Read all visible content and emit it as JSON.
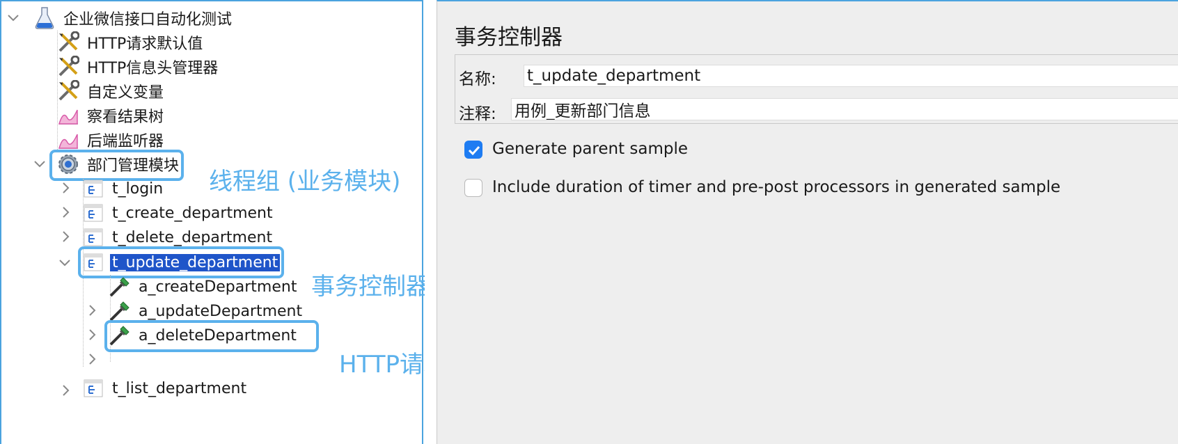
{
  "tree": {
    "root": {
      "label": "企业微信接口自动化测试",
      "icon": "test-plan-flask-icon"
    },
    "config_items": [
      {
        "label": "HTTP请求默认值",
        "icon": "wrench-screwdriver-icon"
      },
      {
        "label": "HTTP信息头管理器",
        "icon": "wrench-screwdriver-icon"
      },
      {
        "label": "自定义变量",
        "icon": "wrench-screwdriver-icon"
      },
      {
        "label": "察看结果树",
        "icon": "listener-chart-icon"
      },
      {
        "label": "后端监听器",
        "icon": "listener-chart-icon"
      }
    ],
    "thread_group": {
      "label": "部门管理模块",
      "icon": "gear-icon"
    },
    "controllers": [
      {
        "label": "t_login",
        "icon": "transaction-controller-icon"
      },
      {
        "label": "t_create_department",
        "icon": "transaction-controller-icon"
      },
      {
        "label": "t_delete_department",
        "icon": "transaction-controller-icon"
      },
      {
        "label": "t_update_department",
        "icon": "transaction-controller-icon",
        "selected": true
      },
      {
        "label": "t_list_department",
        "icon": "transaction-controller-icon"
      }
    ],
    "samplers": [
      {
        "label": "a_createDepartment",
        "icon": "pipette-icon"
      },
      {
        "label": "a_updateDepartment",
        "icon": "pipette-icon"
      },
      {
        "label": "a_deleteDepartment",
        "icon": "pipette-icon"
      }
    ]
  },
  "annotations": {
    "thread_group": "线程组 (业务模块)",
    "transaction": "事务控制器 (测试用例)",
    "http_request": "HTTP请求 (测试步骤)"
  },
  "panel": {
    "title": "事务控制器",
    "name_label": "名称:",
    "name_value": "t_update_department",
    "comment_label": "注释:",
    "comment_value": "用例_更新部门信息",
    "generate_parent_sample": {
      "label": "Generate parent sample",
      "checked": true
    },
    "include_duration": {
      "label": "Include duration of timer and pre-post processors in generated sample",
      "checked": false
    }
  },
  "colors": {
    "accent": "#5bb1ec",
    "selection": "#1f55c9",
    "checkbox": "#1e7cf2"
  }
}
